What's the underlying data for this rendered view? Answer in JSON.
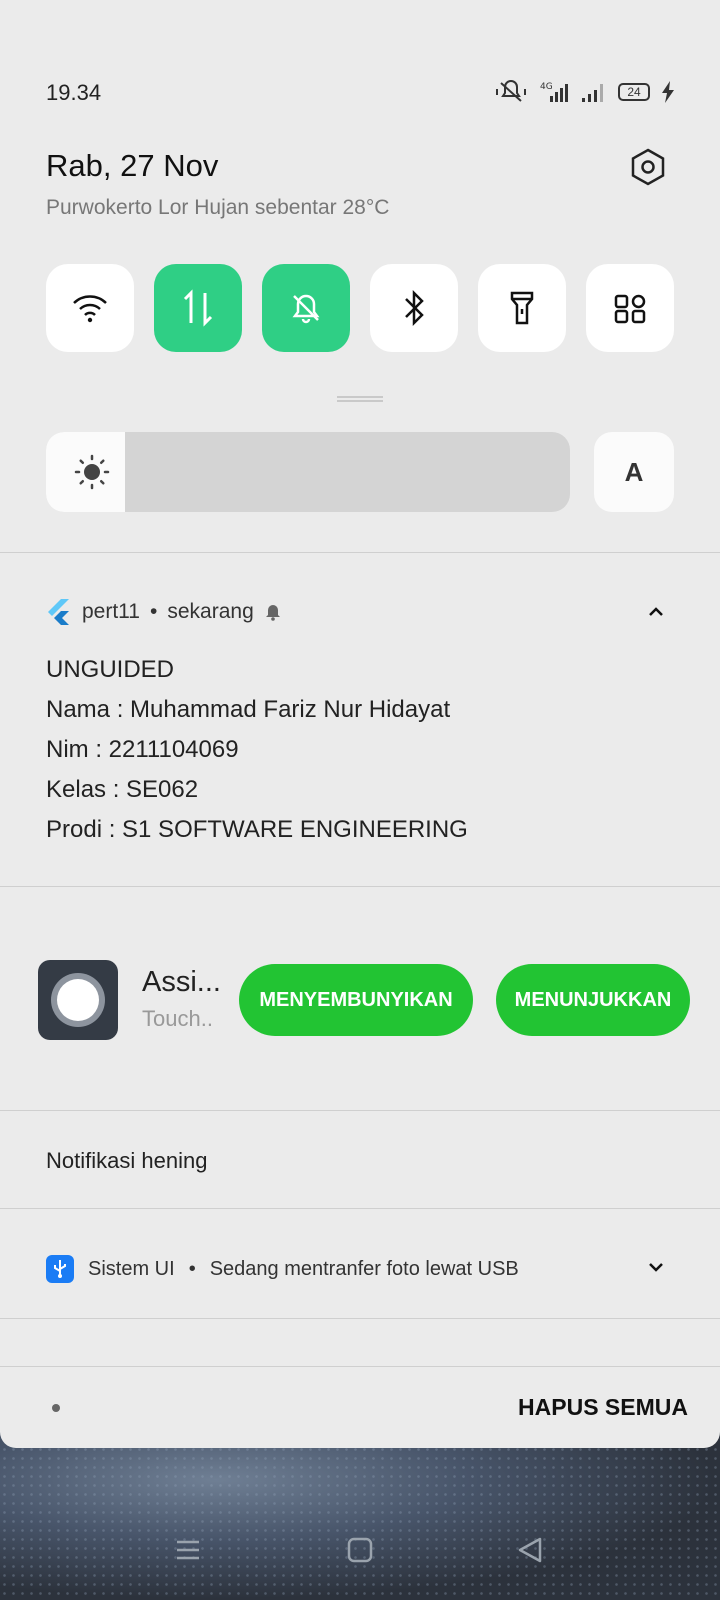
{
  "status_bar": {
    "time": "19.34",
    "battery": "24"
  },
  "header": {
    "date": "Rab, 27 Nov",
    "weather": "Purwokerto Lor Hujan sebentar 28°C"
  },
  "quick_tiles": [
    {
      "name": "wifi",
      "on": false
    },
    {
      "name": "mobile-data",
      "on": true
    },
    {
      "name": "silent-mode",
      "on": true
    },
    {
      "name": "bluetooth",
      "on": false
    },
    {
      "name": "flashlight",
      "on": false
    },
    {
      "name": "more-apps",
      "on": false
    }
  ],
  "brightness": {
    "level": 0.15,
    "auto_label": "A"
  },
  "notification_flutter": {
    "app": "pert11",
    "time": "sekarang",
    "lines": [
      "UNGUIDED",
      "Nama : Muhammad Fariz Nur Hidayat",
      "Nim : 2211104069",
      "Kelas : SE062",
      "Prodi : S1 SOFTWARE ENGINEERING"
    ]
  },
  "assistive": {
    "title": "Assi...",
    "subtitle": "Touch..",
    "hide_label": "MENYEMBUNYIKAN",
    "show_label": "MENUNJUKKAN"
  },
  "silent_section": {
    "label": "Notifikasi hening"
  },
  "usb_notification": {
    "app": "Sistem UI",
    "text": "Sedang mentranfer foto lewat USB"
  },
  "footer": {
    "clear_all": "HAPUS SEMUA"
  },
  "colors": {
    "accent_green": "#2fcf85",
    "button_green": "#22c433",
    "usb_blue": "#1a7cf5"
  }
}
